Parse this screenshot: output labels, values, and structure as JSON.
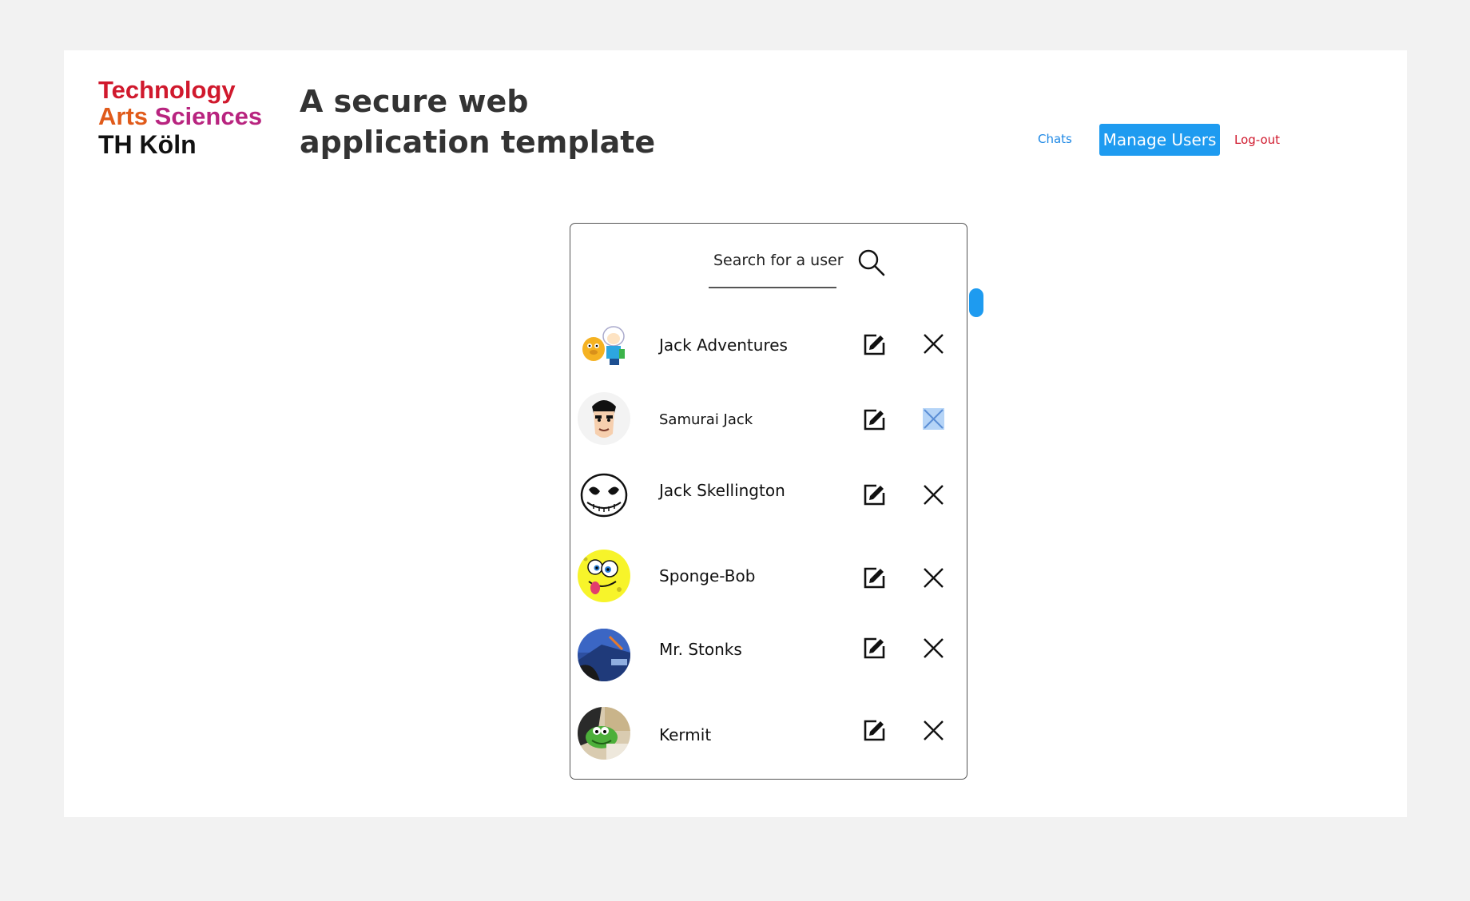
{
  "logo": {
    "line1": "Technology",
    "line2a": "Arts",
    "line2b": "Sciences",
    "line3": "TH Köln"
  },
  "header": {
    "title": "A secure web application template"
  },
  "nav": {
    "chats": "Chats",
    "manage_users": "Manage Users",
    "logout": "Log-out"
  },
  "search": {
    "placeholder": "Search for a user",
    "value": ""
  },
  "users": [
    {
      "name": "Jack Adventures"
    },
    {
      "name": "Samurai Jack"
    },
    {
      "name": "Jack Skellington"
    },
    {
      "name": "Sponge-Bob"
    },
    {
      "name": "Mr. Stonks"
    },
    {
      "name": "Kermit"
    }
  ],
  "colors": {
    "accent": "#1e9bf0",
    "logout": "#d0192d",
    "title": "#333333"
  },
  "icons": {
    "search": "search-icon",
    "edit": "edit-icon",
    "delete": "close-icon"
  }
}
